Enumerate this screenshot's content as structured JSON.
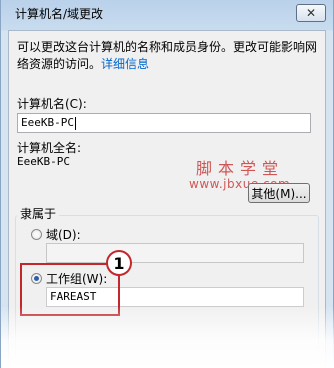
{
  "window": {
    "title": "计算机名/域更改",
    "close_glyph": "✕"
  },
  "description": {
    "text": "可以更改这台计算机的名称和成员身份。更改可能影响网络资源的访问。",
    "link": "详细信息"
  },
  "computer_name": {
    "label": "计算机名(C):",
    "value": "EeeKB-PC"
  },
  "full_name": {
    "label": "计算机全名:",
    "value": "EeeKB-PC"
  },
  "watermark": {
    "site_cn": "脚本学堂",
    "site_url": "www.jbxue.com"
  },
  "other_button": {
    "label": "其他(M)..."
  },
  "member_of": {
    "label": "隶属于",
    "domain_label": "域(D):",
    "domain_value": "",
    "workgroup_label": "工作组(W):",
    "workgroup_value": "FAREAST",
    "selected": "workgroup"
  },
  "annotation": {
    "number": "1",
    "color": "#c1272d"
  }
}
